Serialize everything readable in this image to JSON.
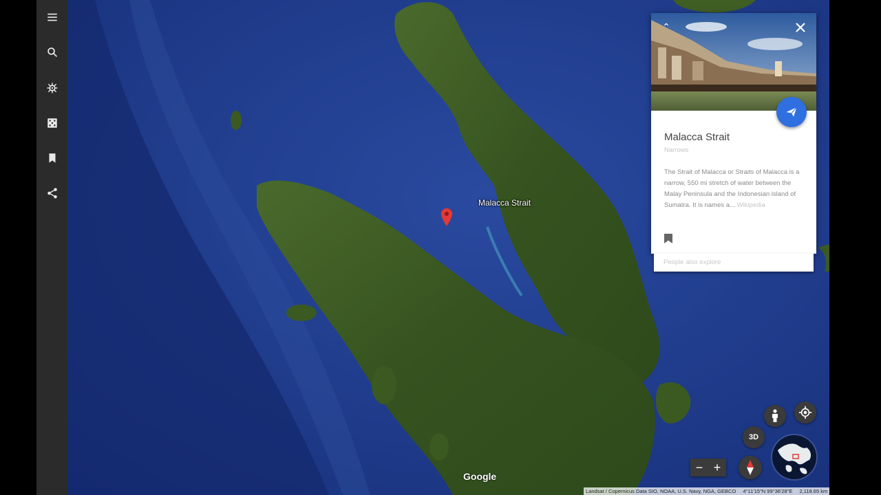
{
  "sidebar": {
    "items": [
      {
        "name": "menu-icon"
      },
      {
        "name": "search-icon"
      },
      {
        "name": "voyager-wheel-icon"
      },
      {
        "name": "feeling-lucky-dice-icon"
      },
      {
        "name": "bookmark-icon"
      },
      {
        "name": "share-icon"
      }
    ]
  },
  "map": {
    "place_label": "Malacca Strait",
    "logo": "Google",
    "attribution": {
      "sources": "Landsat / Copernicus  Data SIO, NOAA, U.S. Navy, NGA, GEBCO",
      "coordinates": "4°11'15\"N 99°36'28\"E",
      "camera": "2,118.65 km"
    }
  },
  "card": {
    "title": "Malacca Strait",
    "subtitle": "Narrows",
    "description": "The Strait of Malacca or Straits of Malacca is a narrow, 550 mi stretch of water between the Malay Peninsula and the Indonesian island of Sumatra. It is names a...",
    "source_link": "Wikipedia",
    "people_also_explore": "People also explore"
  },
  "controls": {
    "mode_3d": "3D",
    "zoom_out": "−",
    "zoom_in": "+"
  },
  "colors": {
    "sidebar": "#2b2b2b",
    "ocean": "#1f3a86",
    "land": "#3d5a24",
    "accent": "#2f6fe0",
    "pin": "#e53935"
  }
}
